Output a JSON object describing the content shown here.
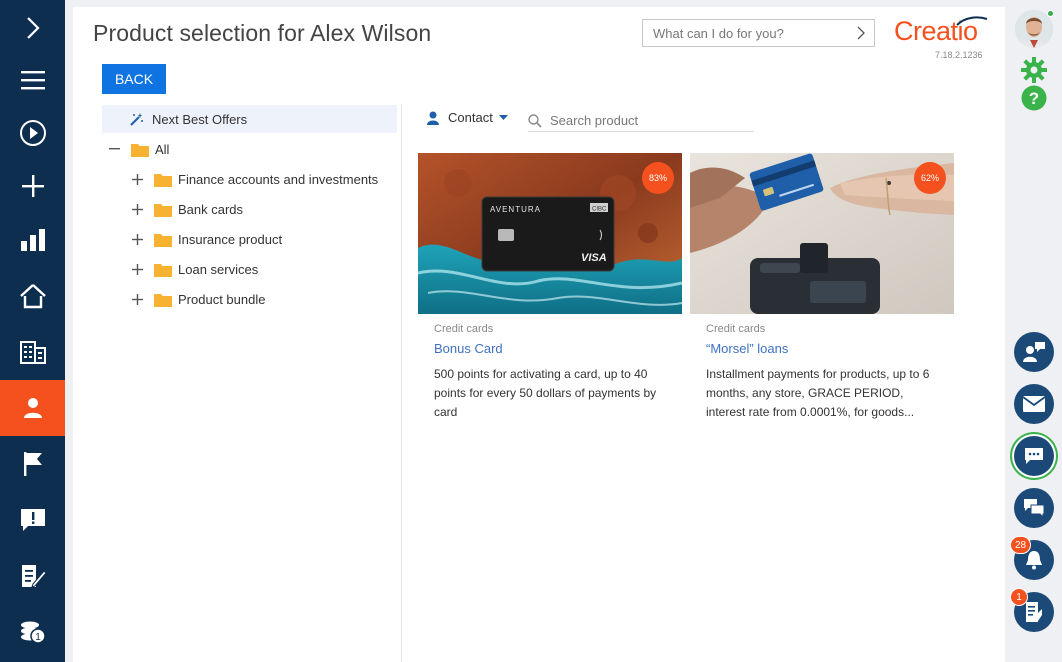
{
  "page": {
    "title": "Product selection for Alex Wilson"
  },
  "header": {
    "command_placeholder": "What can I do for you?",
    "logo_text": "Creatio",
    "version": "7.18.2.1236",
    "back_label": "BACK"
  },
  "leftnav": {
    "items": [
      "expand-icon",
      "menu-icon",
      "play-icon",
      "add-icon",
      "analytics-icon",
      "home-icon",
      "accounts-icon",
      "contacts-icon",
      "leads-icon",
      "cases-icon",
      "documents-icon",
      "products-icon"
    ],
    "active": "contacts-icon"
  },
  "tree": {
    "next_best": "Next Best Offers",
    "root": "All",
    "items": [
      "Finance accounts and investments",
      "Bank cards",
      "Insurance product",
      "Loan services",
      "Product bundle"
    ]
  },
  "filter": {
    "contact_label": "Contact",
    "search_placeholder": "Search product"
  },
  "cards": [
    {
      "badge": "83%",
      "category": "Credit cards",
      "name": "Bonus Card",
      "description": "500 points for activating a card, up to 40 points for every 50 dollars of payments by card"
    },
    {
      "badge": "62%",
      "category": "Credit cards",
      "name": "“Morsel” loans",
      "description": "Installment payments for products, up to 6 months, any store, GRACE PERIOD, interest rate from 0.0001%, for goods..."
    }
  ],
  "card_image_text": {
    "card_brand": "AVENTURA",
    "card_bank": "CIBC",
    "card_network": "VISA"
  },
  "rightbar": {
    "notifications_count": "28",
    "tasks_count": "1"
  },
  "colors": {
    "nav_bg": "#0d2e4e",
    "accent": "#f4511e",
    "primary_button": "#0f73e2",
    "link": "#3e71c4",
    "rightbar_button": "#1b4a78",
    "status_green": "#3ab34a"
  }
}
